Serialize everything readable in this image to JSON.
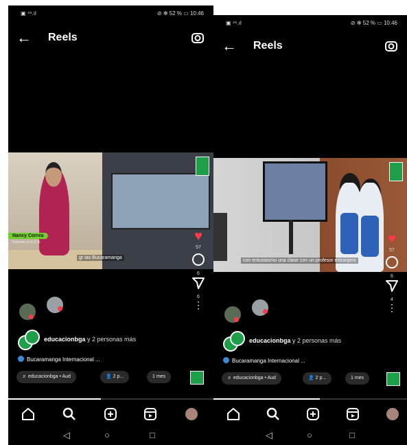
{
  "panels": [
    {
      "status": {
        "left": "▣ ⁴⁶.ıl",
        "right": "⊘ ✻ 52 % ▭ 10:46"
      },
      "header": {
        "title": "Reels"
      },
      "video": {
        "name_tag": "Nancy Correa",
        "name_sub": "Docente en E.C.B.",
        "caption": "gr  ias Bucaramanga"
      },
      "likes": "57",
      "comments": "6",
      "shares": "6",
      "user": {
        "handle": "educacionbga",
        "rest": "y 2 personas más"
      },
      "location": "Bucaramanga Internacional ...",
      "chips": {
        "music": "♬ educacionbga • Aud",
        "people": "👤 2 p...",
        "time": "1 mes"
      },
      "progress": 0.45
    },
    {
      "status": {
        "left": "▣ ⁴⁶.ıl",
        "right": "⊘ ✻ 52 % ▭ 10:46"
      },
      "header": {
        "title": "Reels"
      },
      "video": {
        "caption": "con entusiasmo una clase con un profesor extranjero"
      },
      "likes": "57",
      "comments": "6",
      "shares": "4",
      "user": {
        "handle": "educacionbga",
        "rest": "y 2 personas más"
      },
      "location": "Bucaramanga Internacional ...",
      "chips": {
        "music": "♬ educacionbga • Aud",
        "people": "👤 2 p...",
        "time": "1 mes"
      },
      "progress": 0.55
    }
  ],
  "icons": [
    "back-arrow-icon",
    "camera-icon",
    "heart-icon",
    "comment-icon",
    "share-icon",
    "more-icon",
    "home-icon",
    "search-icon",
    "create-icon",
    "reels-icon",
    "profile-avatar",
    "back-triangle-icon",
    "home-circle-icon",
    "recents-square-icon"
  ],
  "colors": {
    "background": "#000000",
    "like": "#ff3b4a",
    "brand_green": "#1f9e4a",
    "name_tag": "#6fcf2f"
  }
}
